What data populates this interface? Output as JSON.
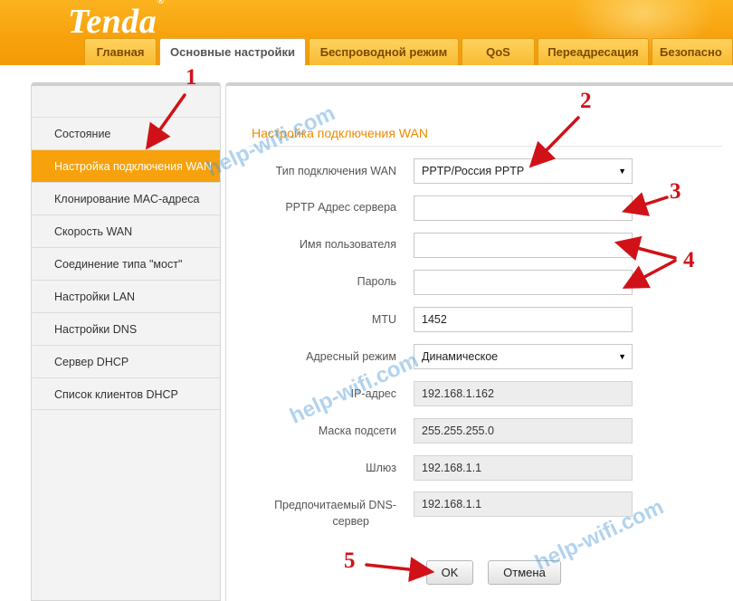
{
  "brand": {
    "logo": "Tenda",
    "reg": "®"
  },
  "tabs": [
    {
      "label": "Главная",
      "active": false
    },
    {
      "label": "Основные настройки",
      "active": true
    },
    {
      "label": "Беспроводной режим",
      "active": false
    },
    {
      "label": "QoS",
      "active": false
    },
    {
      "label": "Переадресация",
      "active": false
    },
    {
      "label": "Безопасно",
      "active": false
    }
  ],
  "sidebar": {
    "items": [
      {
        "label": "Состояние"
      },
      {
        "label": "Настройка подключения WAN",
        "active": true
      },
      {
        "label": "Клонирование MAC-адреса"
      },
      {
        "label": "Скорость WAN"
      },
      {
        "label": "Соединение типа \"мост\""
      },
      {
        "label": "Настройки LAN"
      },
      {
        "label": "Настройки DNS"
      },
      {
        "label": "Сервер DHCP"
      },
      {
        "label": "Список клиентов DHCP"
      }
    ]
  },
  "main": {
    "title": "Настройка подключения WAN",
    "wan_type": {
      "label": "Тип подключения WAN",
      "value": "PPTP/Россия PPTP"
    },
    "server": {
      "label": "PPTP Адрес сервера",
      "value": ""
    },
    "username": {
      "label": "Имя пользователя",
      "value": ""
    },
    "password": {
      "label": "Пароль",
      "value": ""
    },
    "mtu": {
      "label": "MTU",
      "value": "1452"
    },
    "addr_mode": {
      "label": "Адресный режим",
      "value": "Динамическое"
    },
    "ip": {
      "label": "IP-адрес",
      "value": "192.168.1.162"
    },
    "mask": {
      "label": "Маска подсети",
      "value": "255.255.255.0"
    },
    "gateway": {
      "label": "Шлюз",
      "value": "192.168.1.1"
    },
    "dns": {
      "label_line1": "Предпочитаемый DNS-",
      "label_line2": "сервер",
      "value": "192.168.1.1"
    },
    "ok_label": "OK",
    "cancel_label": "Отмена"
  },
  "watermark": "help-wifi.com",
  "annotations": [
    "1",
    "2",
    "3",
    "4",
    "5"
  ],
  "colors": {
    "accent": "#f7a10c",
    "annotation": "#d01218",
    "watermark": "#4696d7"
  }
}
